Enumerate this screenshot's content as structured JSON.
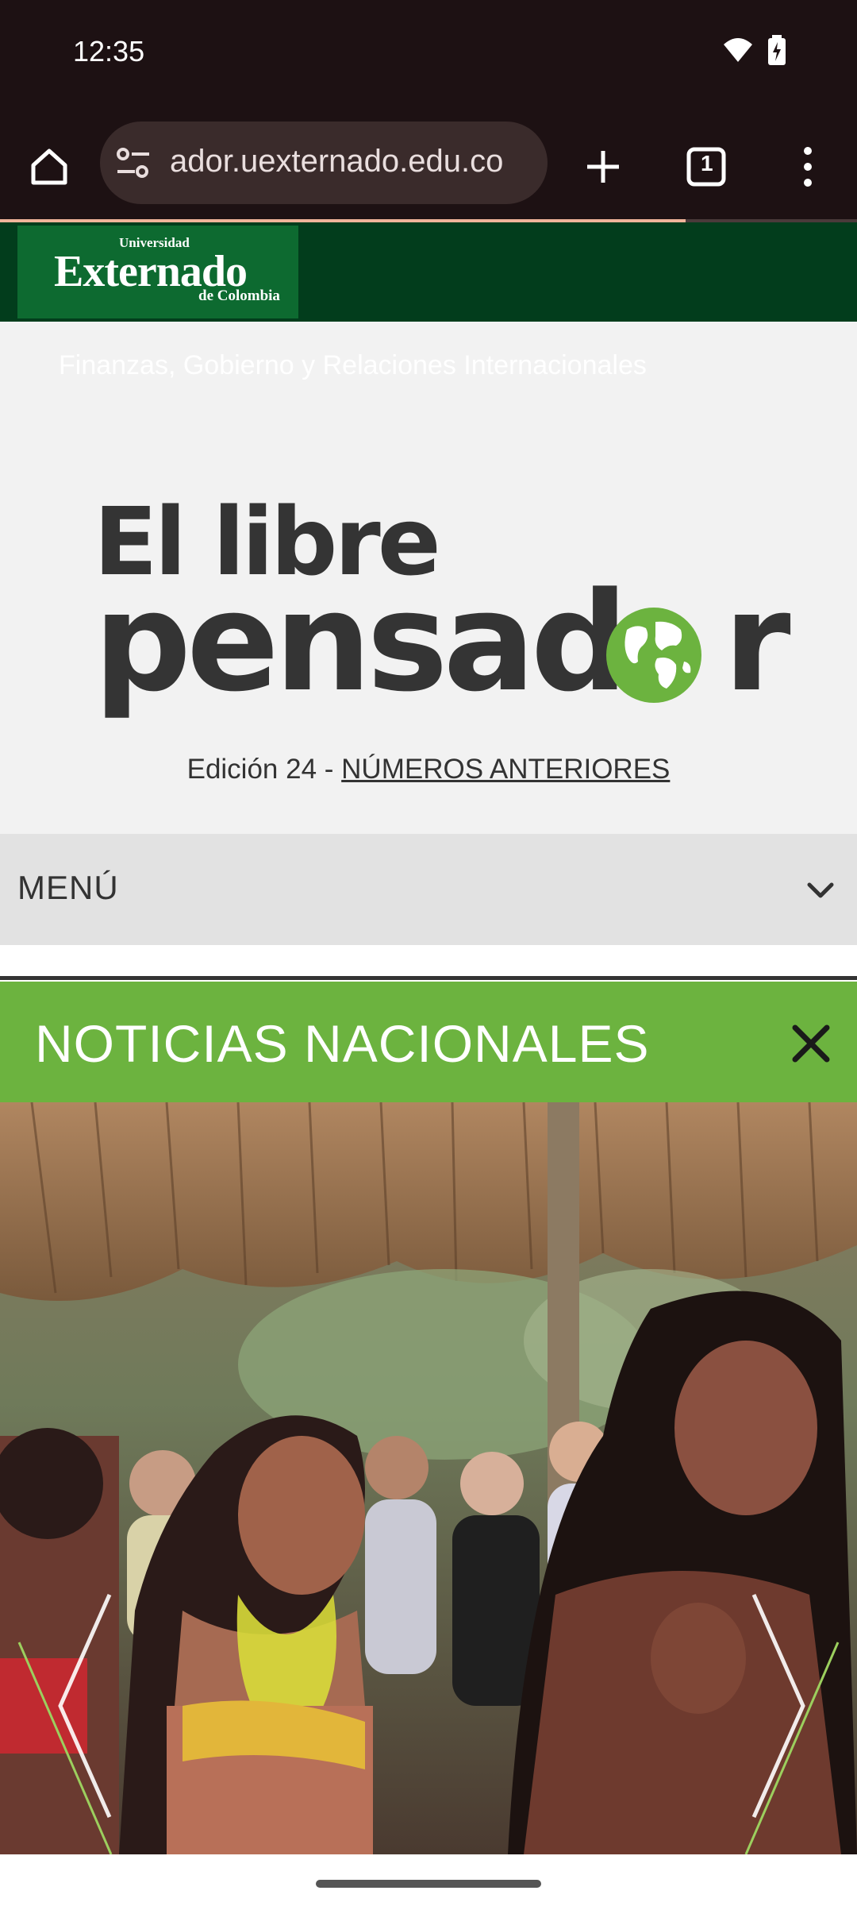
{
  "status_bar": {
    "time": "12:35"
  },
  "browser": {
    "url": "ador.uexternado.edu.co",
    "tab_count": "1",
    "load_progress": 0.8
  },
  "university": {
    "small": "Universidad",
    "name": "Externado",
    "sub": "de Colombia"
  },
  "banner": {
    "faculty": "Finanzas, Gobierno y Relaciones Internacionales",
    "logo_line1": "El libre",
    "logo_line2_a": "pensad",
    "logo_line2_b": "r",
    "edition": "Edición 24 - ",
    "previous_link": "NÚMEROS ANTERIORES"
  },
  "menu": {
    "label": "MENÚ"
  },
  "section": {
    "title": "NOTICIAS NACIONALES"
  },
  "colors": {
    "browser_bg": "#1d1113",
    "uni_green": "#023d1c",
    "accent_green": "#6cb33f"
  }
}
